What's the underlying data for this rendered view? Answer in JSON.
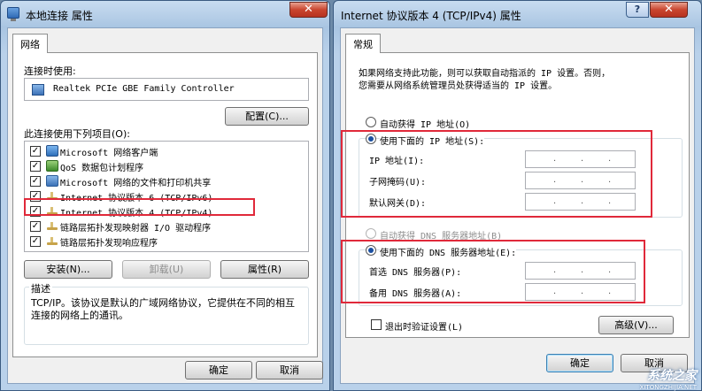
{
  "left_window": {
    "title": "本地连接 属性",
    "tab": "网络",
    "connect_using_label": "连接时使用:",
    "adapter_name": "Realtek PCIe GBE Family Controller",
    "configure_button": "配置(C)...",
    "items_label": "此连接使用下列项目(O):",
    "items": [
      {
        "label": "Microsoft 网络客户端",
        "checked": true,
        "icon": "network-client-icon"
      },
      {
        "label": "QoS 数据包计划程序",
        "checked": true,
        "icon": "qos-icon"
      },
      {
        "label": "Microsoft 网络的文件和打印机共享",
        "checked": true,
        "icon": "file-sharing-icon"
      },
      {
        "label": "Internet 协议版本 6 (TCP/IPv6)",
        "checked": true,
        "icon": "protocol-icon"
      },
      {
        "label": "Internet 协议版本 4 (TCP/IPv4)",
        "checked": true,
        "icon": "protocol-icon"
      },
      {
        "label": "链路层拓扑发现映射器 I/O 驱动程序",
        "checked": true,
        "icon": "protocol-icon"
      },
      {
        "label": "链路层拓扑发现响应程序",
        "checked": true,
        "icon": "protocol-icon"
      }
    ],
    "install_button": "安装(N)...",
    "uninstall_button": "卸载(U)",
    "properties_button": "属性(R)",
    "description_title": "描述",
    "description_text": "TCP/IP。该协议是默认的广域网络协议，它提供在不同的相互连接的网络上的通讯。",
    "ok_button": "确定",
    "cancel_button": "取消",
    "close_glyph": "✕"
  },
  "right_window": {
    "title": "Internet 协议版本 4 (TCP/IPv4) 属性",
    "tab": "常规",
    "intro_text_line1": "如果网络支持此功能，则可以获取自动指派的 IP 设置。否则，",
    "intro_text_line2": "您需要从网络系统管理员处获得适当的 IP 设置。",
    "auto_ip_label": "自动获得 IP 地址(O)",
    "manual_ip_label": "使用下面的 IP 地址(S):",
    "ip_address_label": "IP 地址(I):",
    "subnet_mask_label": "子网掩码(U):",
    "default_gateway_label": "默认网关(D):",
    "auto_dns_label": "自动获得 DNS 服务器地址(B)",
    "manual_dns_label": "使用下面的 DNS 服务器地址(E):",
    "preferred_dns_label": "首选 DNS 服务器(P):",
    "alternate_dns_label": "备用 DNS 服务器(A):",
    "validate_label": "退出时验证设置(L)",
    "advanced_button": "高级(V)...",
    "ok_button_partial": "确定",
    "cancel_button_partial": "取消",
    "help_glyph": "?",
    "close_glyph": "✕",
    "ip_dot": ".",
    "manual_ip_selected": true,
    "manual_dns_selected": true,
    "validate_checked": false
  },
  "watermark": {
    "text": "系统之家",
    "url": "XITONGZHIJIA.NET"
  },
  "colors": {
    "highlight_box": "#e0293a",
    "title_bar": "#b9d1ea",
    "close_button": "#c9452f"
  }
}
